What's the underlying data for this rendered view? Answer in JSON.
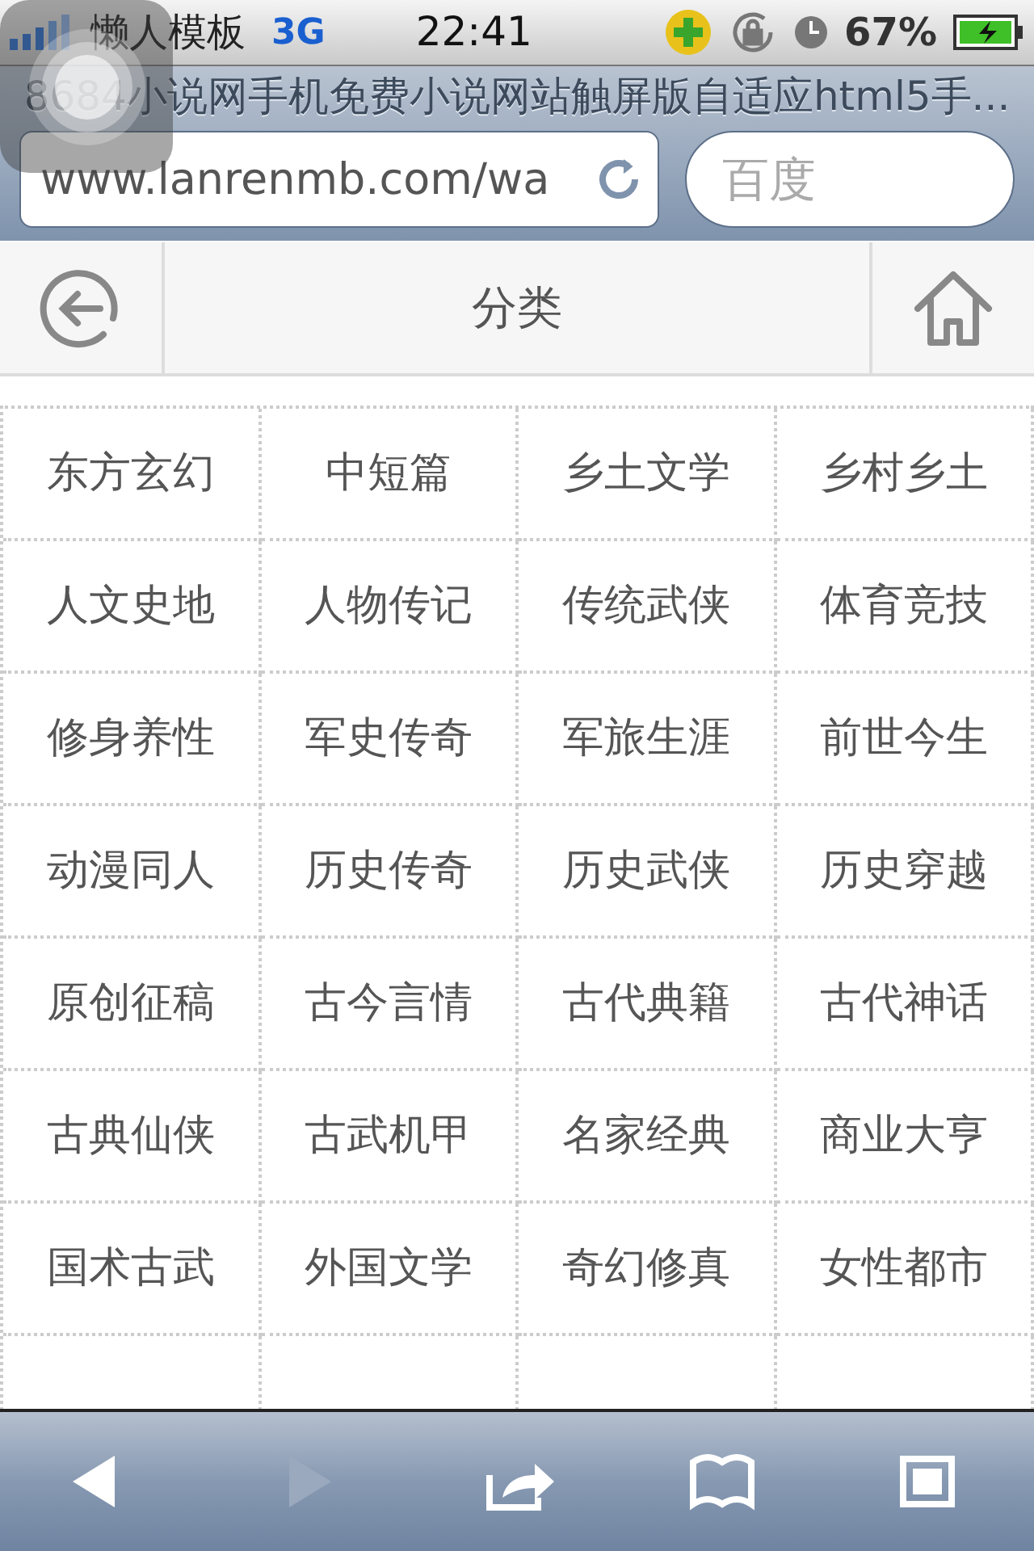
{
  "status_bar": {
    "carrier": "懒人模板",
    "network": "3G",
    "time": "22:41",
    "battery": "67%"
  },
  "browser": {
    "title": "8684小说网手机免费小说网站触屏版自适应html5手...",
    "url": "www.lanrenmb.com/wa",
    "search": {
      "placeholder": "百度"
    }
  },
  "header": {
    "title": "分类"
  },
  "categories": [
    "东方玄幻",
    "中短篇",
    "乡土文学",
    "乡村乡土",
    "人文史地",
    "人物传记",
    "传统武侠",
    "体育竞技",
    "修身养性",
    "军史传奇",
    "军旅生涯",
    "前世今生",
    "动漫同人",
    "历史传奇",
    "历史武侠",
    "历史穿越",
    "原创征稿",
    "古今言情",
    "古代典籍",
    "古代神话",
    "古典仙侠",
    "古武机甲",
    "名家经典",
    "商业大亨",
    "国术古武",
    "外国文学",
    "奇幻修真",
    "女性都市"
  ],
  "toolbar": [
    {
      "kind": "back",
      "disabled": false
    },
    {
      "kind": "forward",
      "disabled": true
    },
    {
      "kind": "share",
      "disabled": false
    },
    {
      "kind": "bookmarks",
      "disabled": false
    },
    {
      "kind": "tabs",
      "disabled": false
    }
  ]
}
